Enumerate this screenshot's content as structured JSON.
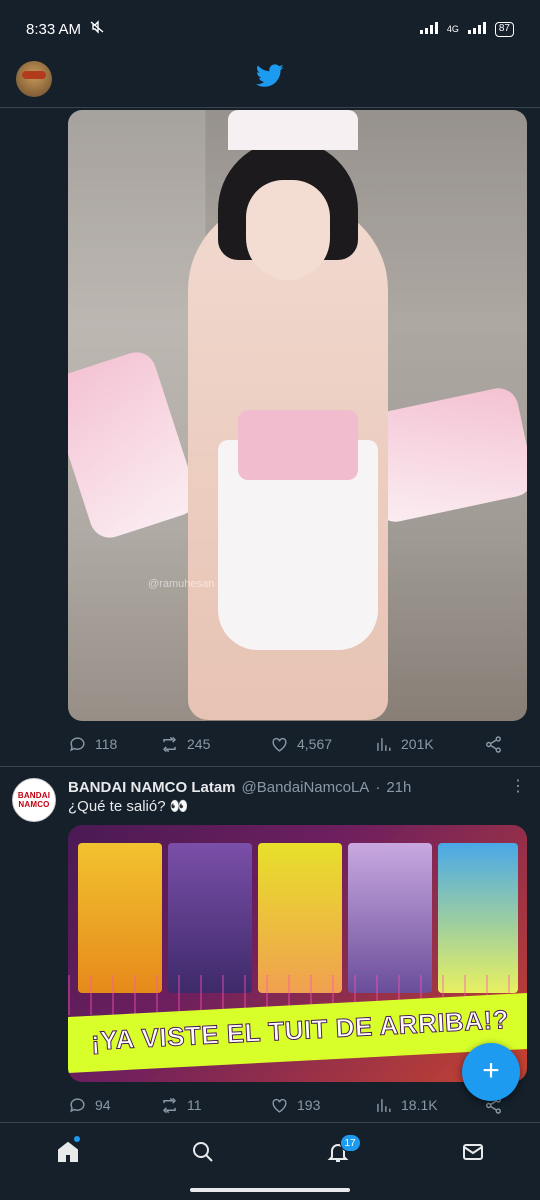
{
  "status_bar": {
    "time": "8:33 AM",
    "network": "4G",
    "battery": "87"
  },
  "tweet1": {
    "image_watermark": "@ramuhesan",
    "actions": {
      "replies": "118",
      "retweets": "245",
      "likes": "4,567",
      "views": "201K"
    }
  },
  "tweet2": {
    "avatar_text_line1": "BANDAI",
    "avatar_text_line2": "NAMCO",
    "name": "BANDAI NAMCO Latam",
    "handle": "@BandaiNamcoLA",
    "separator": "·",
    "time": "21h",
    "text": "¿Qué te salió? 👀",
    "image_banner": "¡YA VISTE EL TUIT DE ARRIBA!?",
    "actions": {
      "replies": "94",
      "retweets": "11",
      "likes": "193",
      "views": "18.1K"
    }
  },
  "fab": {
    "label": "+"
  },
  "bottom_nav": {
    "notifications_badge": "17"
  },
  "colors": {
    "background": "#15202b",
    "accent": "#1d9bf0",
    "muted": "#8b98a5"
  }
}
